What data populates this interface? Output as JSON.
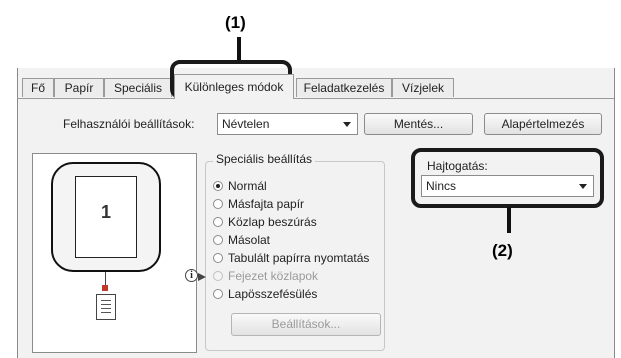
{
  "callouts": {
    "one": "(1)",
    "two": "(2)"
  },
  "tabs": [
    {
      "label": "Fő",
      "active": false
    },
    {
      "label": "Papír",
      "active": false
    },
    {
      "label": "Speciális",
      "active": false
    },
    {
      "label": "Különleges módok",
      "active": true
    },
    {
      "label": "Feladatkezelés",
      "active": false
    },
    {
      "label": "Vízjelek",
      "active": false
    }
  ],
  "user_settings": {
    "label": "Felhasználói beállítások:",
    "value": "Névtelen",
    "save_label": "Mentés...",
    "default_label": "Alapértelmezés"
  },
  "preview": {
    "page_number": "1"
  },
  "special": {
    "title": "Speciális beállítás",
    "options": [
      {
        "label": "Normál",
        "checked": true,
        "disabled": false
      },
      {
        "label": "Másfajta papír",
        "checked": false,
        "disabled": false
      },
      {
        "label": "Közlap beszúrás",
        "checked": false,
        "disabled": false
      },
      {
        "label": "Másolat",
        "checked": false,
        "disabled": false
      },
      {
        "label": "Tabulált papírra nyomtatás",
        "checked": false,
        "disabled": false
      },
      {
        "label": "Fejezet közlapok",
        "checked": false,
        "disabled": true
      },
      {
        "label": "Lapösszefésülés",
        "checked": false,
        "disabled": false
      }
    ],
    "settings_button": "Beállítások..."
  },
  "folding": {
    "label": "Hajtogatás:",
    "value": "Nincs"
  }
}
